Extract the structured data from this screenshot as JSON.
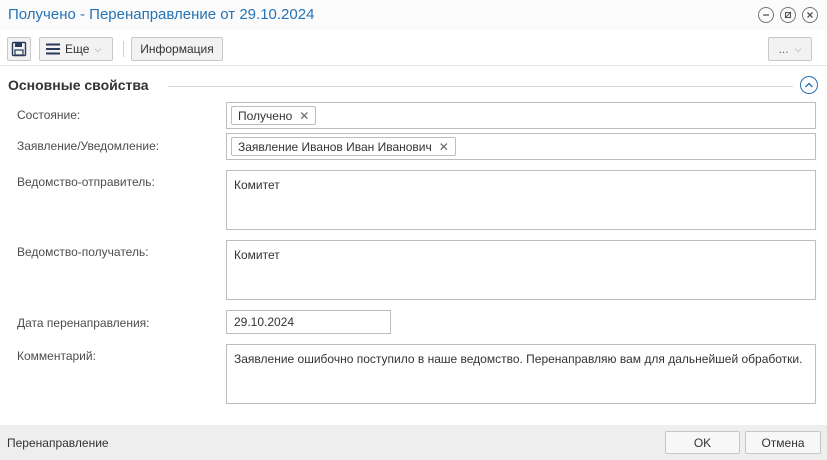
{
  "window": {
    "title": "Получено - Перенаправление от 29.10.2024"
  },
  "toolbar": {
    "more_label": "Еще",
    "info_label": "Информация",
    "dots_label": "..."
  },
  "section": {
    "title": "Основные свойства"
  },
  "fields": {
    "status": {
      "label": "Состояние:",
      "tag": "Получено"
    },
    "application": {
      "label": "Заявление/Уведомление:",
      "tag": "Заявление Иванов Иван Иванович"
    },
    "sender": {
      "label": "Ведомство-отправитель:",
      "value": "Комитет"
    },
    "receiver": {
      "label": "Ведомство-получатель:",
      "value": "Комитет"
    },
    "date": {
      "label": "Дата перенаправления:",
      "value": "29.10.2024"
    },
    "comment": {
      "label": "Комментарий:",
      "value": "Заявление ошибочно поступило в наше ведомство. Перенаправляю вам для дальнейшей обработки."
    }
  },
  "footer": {
    "label": "Перенаправление",
    "ok_label": "OK",
    "cancel_label": "Отмена"
  },
  "colors": {
    "title_blue": "#2673b6",
    "footer_bg": "#eeeeee"
  }
}
